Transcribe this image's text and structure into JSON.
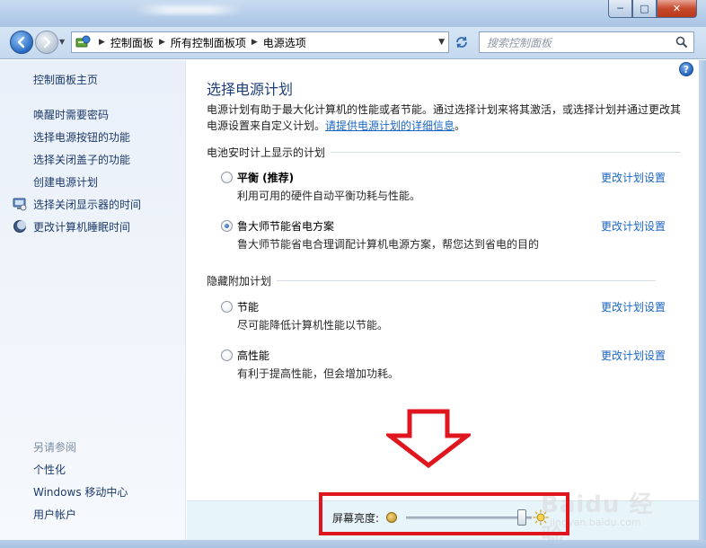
{
  "window": {
    "controls": {
      "minimize": "─",
      "maximize": "□",
      "close": "✕"
    }
  },
  "address": {
    "crumbs": [
      "控制面板",
      "所有控制面板项",
      "电源选项"
    ],
    "search_placeholder": "搜索控制面板"
  },
  "sidebar": {
    "home": "控制面板主页",
    "items": [
      {
        "label": "唤醒时需要密码",
        "icon": ""
      },
      {
        "label": "选择电源按钮的功能",
        "icon": ""
      },
      {
        "label": "选择关闭盖子的功能",
        "icon": ""
      },
      {
        "label": "创建电源计划",
        "icon": ""
      },
      {
        "label": "选择关闭显示器的时间",
        "icon": "monitor-icon"
      },
      {
        "label": "更改计算机睡眠时间",
        "icon": "moon-icon"
      }
    ],
    "see_also": "另请参阅",
    "see_also_items": [
      "个性化",
      "Windows 移动中心",
      "用户帐户"
    ]
  },
  "main": {
    "title": "选择电源计划",
    "intro_line1": "电源计划有助于最大化计算机的性能或者节能。通过选择计划来将其激活，或选择计划并通过更改其",
    "intro_line2_prefix": "电源设置来自定义计划。",
    "intro_link": "请提供电源计划的详细信息",
    "intro_line2_suffix": "。",
    "battery_group": "电池安时计上显示的计划",
    "hidden_group": "隐藏附加计划",
    "plans": [
      {
        "name": "平衡 (推荐)",
        "desc": "利用可用的硬件自动平衡功耗与性能。",
        "link": "更改计划设置",
        "selected": false
      },
      {
        "name": "鲁大师节能省电方案",
        "desc": "鲁大师节能省电合理调配计算机电源方案，帮您达到省电的目的",
        "link": "更改计划设置",
        "selected": true
      },
      {
        "name": "节能",
        "desc": "尽可能降低计算机性能以节能。",
        "link": "更改计划设置",
        "selected": false
      },
      {
        "name": "高性能",
        "desc": "有利于提高性能，但会增加功耗。",
        "link": "更改计划设置",
        "selected": false
      }
    ]
  },
  "brightness": {
    "label": "屏幕亮度:",
    "level": 0.92
  },
  "watermark": {
    "brand": "Baidu 经验",
    "sub": "jingyan.baidu.com"
  },
  "colors": {
    "highlight_box": "#e0161e",
    "link": "#1b66c4",
    "title": "#1e3f7a"
  }
}
